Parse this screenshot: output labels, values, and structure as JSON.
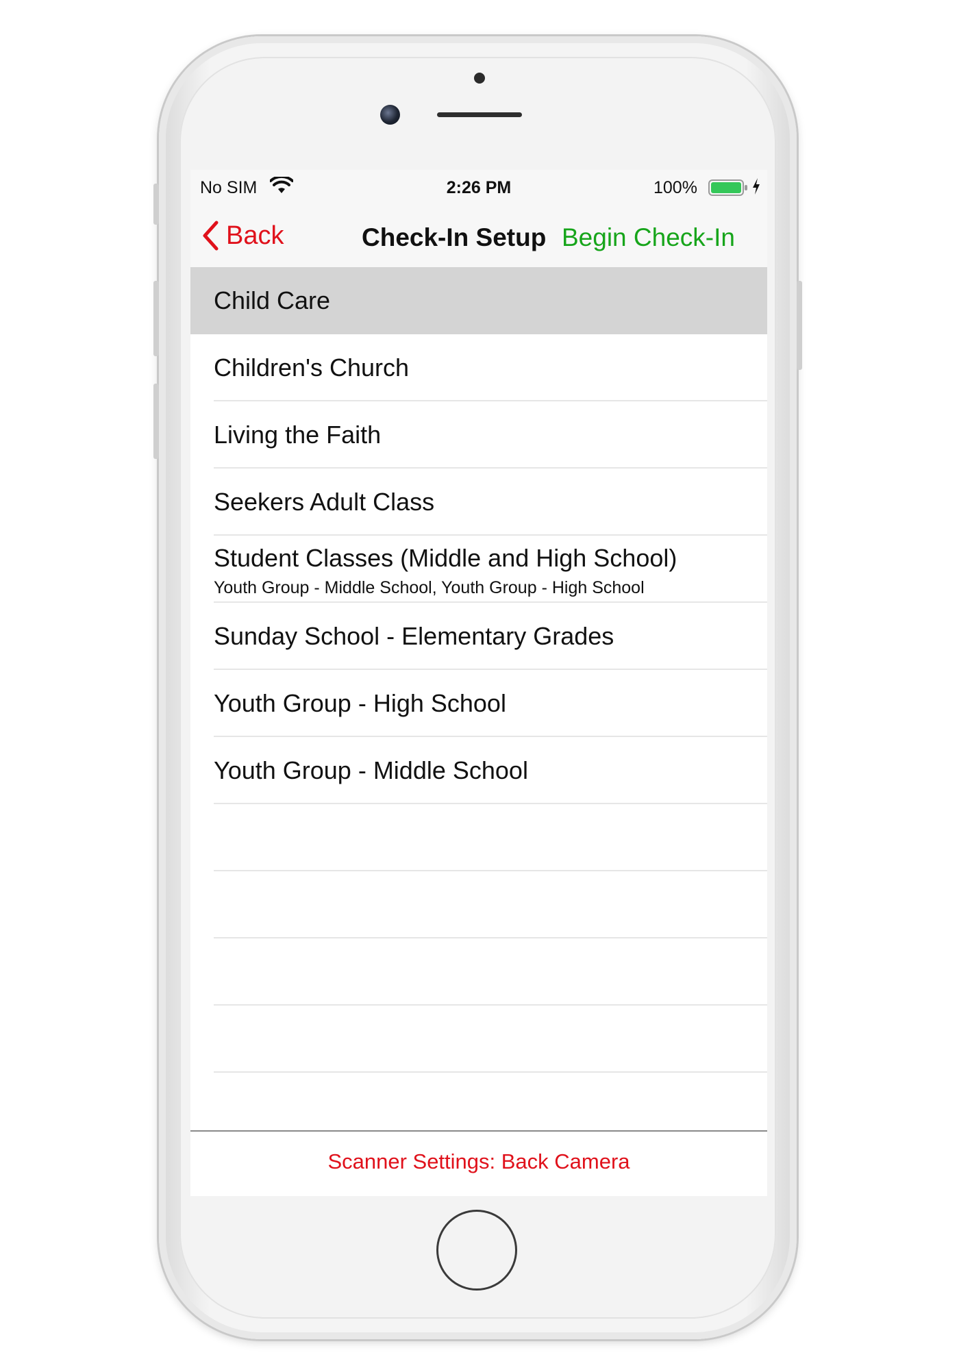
{
  "status_bar": {
    "carrier": "No SIM",
    "time": "2:26 PM",
    "battery_percent": "100%",
    "battery_level": 1.0,
    "battery_color": "#34c759"
  },
  "nav": {
    "back_label": "Back",
    "title": "Check-In Setup",
    "action_label": "Begin Check-In"
  },
  "list": {
    "items": [
      {
        "title": "Child Care",
        "selected": true
      },
      {
        "title": "Children's Church"
      },
      {
        "title": "Living the Faith"
      },
      {
        "title": "Seekers Adult Class"
      },
      {
        "title": "Student Classes (Middle and High School)",
        "subtitle": "Youth Group - Middle School, Youth Group - High School"
      },
      {
        "title": "Sunday School - Elementary Grades"
      },
      {
        "title": "Youth Group - High School"
      },
      {
        "title": "Youth Group - Middle School"
      }
    ]
  },
  "footer": {
    "scanner_settings_label": "Scanner Settings: Back Camera"
  },
  "colors": {
    "accent_red": "#e0111b",
    "accent_green": "#17a51b",
    "selected_row": "#d4d4d4"
  }
}
